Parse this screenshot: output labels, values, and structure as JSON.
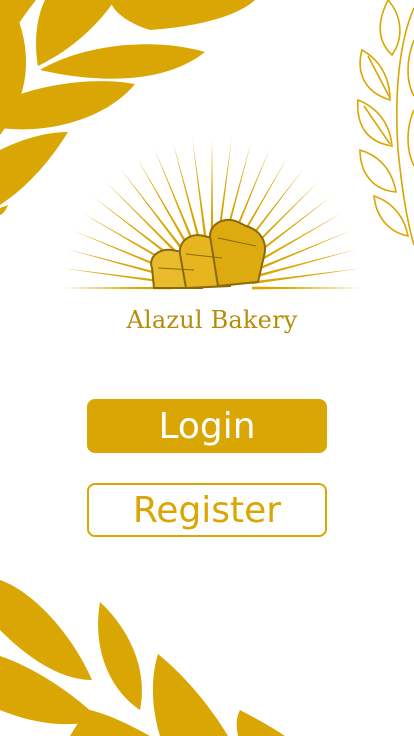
{
  "brand": {
    "name": "Alazul Bakery",
    "accent_color": "#DAA603",
    "logo_icon": "bread-sunburst-icon"
  },
  "actions": {
    "login_label": "Login",
    "register_label": "Register"
  },
  "decorations": {
    "top_left": "wheat-leaves-icon",
    "top_right": "wheat-stalk-icon",
    "bottom_left": "wheat-leaves-icon"
  }
}
